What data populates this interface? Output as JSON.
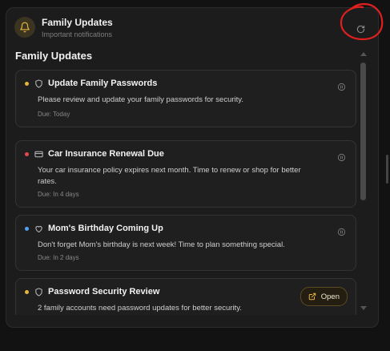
{
  "header": {
    "title": "Family Updates",
    "subtitle": "Important notifications"
  },
  "section_title": "Family Updates",
  "notifications": [
    {
      "dot_color": "#e6b53a",
      "icon": "shield-icon",
      "title": "Update Family Passwords",
      "description": "Please review and update your family passwords for security.",
      "due": "Due: Today"
    },
    {
      "dot_color": "#e5484d",
      "icon": "credit-card-icon",
      "title": "Car Insurance Renewal Due",
      "description": "Your car insurance policy expires next month. Time to renew or shop for better rates.",
      "due": "Due: In 4 days"
    },
    {
      "dot_color": "#4ea3f0",
      "icon": "heart-icon",
      "title": "Mom's Birthday Coming Up",
      "description": "Don't forget Mom's birthday is next week! Time to plan something special.",
      "due": "Due: In 2 days"
    },
    {
      "dot_color": "#e6b53a",
      "icon": "shield-icon",
      "title": "Password Security Review",
      "description": "2 family accounts need password updates for better security.",
      "action_label": "Open"
    }
  ],
  "colors": {
    "accent": "#e6b53a",
    "annotation": "#e02020",
    "background": "#1c1c1c"
  }
}
